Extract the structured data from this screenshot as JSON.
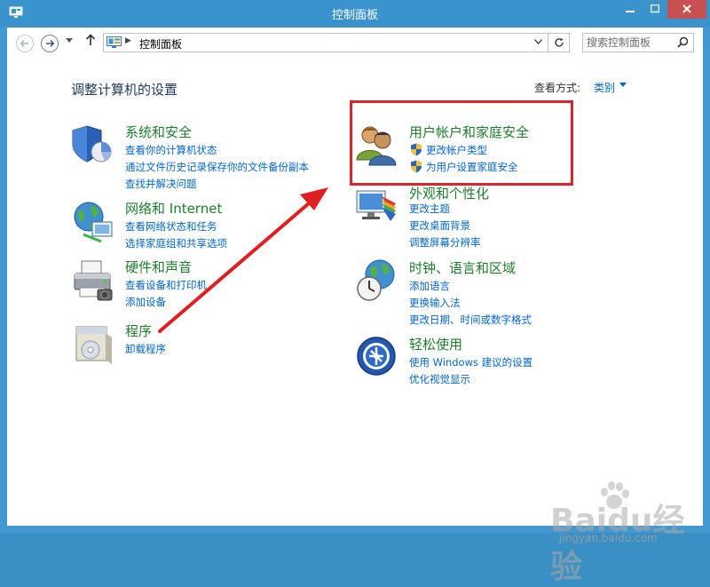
{
  "window": {
    "title": "控制面板"
  },
  "nav": {
    "path": "控制面板",
    "search_placeholder": "搜索控制面板"
  },
  "page": {
    "heading": "调整计算机的设置",
    "view_by_label": "查看方式:",
    "view_by_value": "类别"
  },
  "categories": [
    {
      "title": "系统和安全",
      "links": [
        "查看你的计算机状态",
        "通过文件历史记录保存你的文件备份副本",
        "查找并解决问题"
      ]
    },
    {
      "title": "网络和 Internet",
      "links": [
        "查看网络状态和任务",
        "选择家庭组和共享选项"
      ]
    },
    {
      "title": "硬件和声音",
      "links": [
        "查看设备和打印机",
        "添加设备"
      ]
    },
    {
      "title": "程序",
      "links": [
        "卸载程序"
      ]
    },
    {
      "title": "用户帐户和家庭安全",
      "links": [
        "更改帐户类型",
        "为用户设置家庭安全"
      ]
    },
    {
      "title": "外观和个性化",
      "links": [
        "更改主题",
        "更改桌面背景",
        "调整屏幕分辨率"
      ]
    },
    {
      "title": "时钟、语言和区域",
      "links": [
        "添加语言",
        "更换输入法",
        "更改日期、时间或数字格式"
      ]
    },
    {
      "title": "轻松使用",
      "links": [
        "使用 Windows 建议的设置",
        "优化视觉显示"
      ]
    }
  ],
  "annotation": {
    "highlight_color": "#d9252d",
    "arrow_color": "#e02020"
  },
  "watermark": {
    "brand": "Baidu经验",
    "url": "jingyan.baidu.com"
  }
}
